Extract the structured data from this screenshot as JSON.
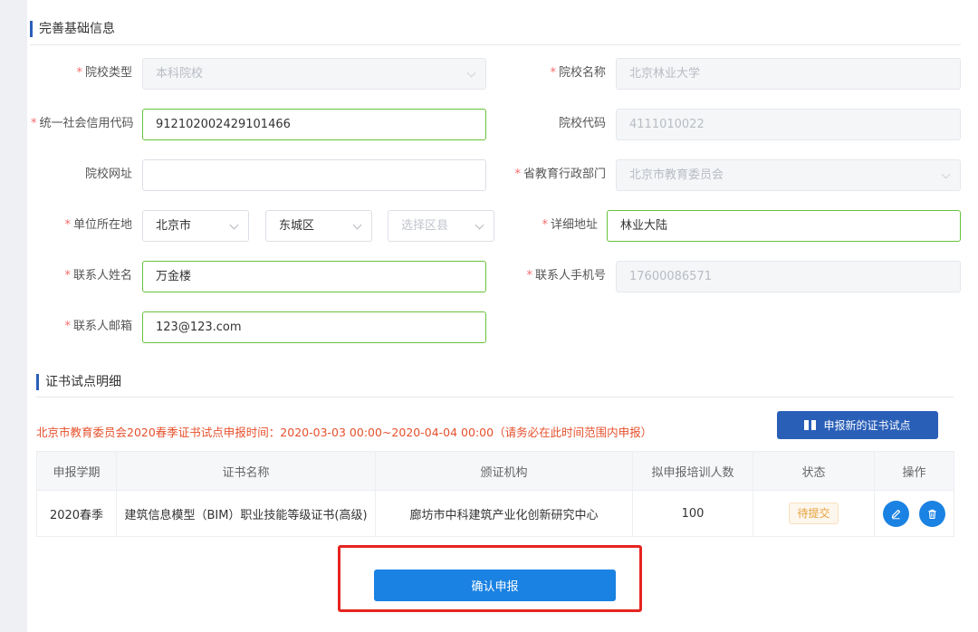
{
  "section1": {
    "title": "完善基础信息"
  },
  "form": {
    "required_mark": "*",
    "school_type": {
      "label": "院校类型",
      "value": "本科院校"
    },
    "school_name": {
      "label": "院校名称",
      "value": "北京林业大学"
    },
    "credit_code": {
      "label": "统一社会信用代码",
      "value": "912102002429101466"
    },
    "school_code": {
      "label": "院校代码",
      "value": "4111010022"
    },
    "website": {
      "label": "院校网址",
      "value": ""
    },
    "edu_dept": {
      "label": "省教育行政部门",
      "value": "北京市教育委员会"
    },
    "location": {
      "label": "单位所在地",
      "city": "北京市",
      "district": "东城区",
      "county_placeholder": "选择区县"
    },
    "address": {
      "label": "详细地址",
      "value": "林业大陆"
    },
    "contact_name": {
      "label": "联系人姓名",
      "value": "万金楼"
    },
    "contact_phone": {
      "label": "联系人手机号",
      "value": "17600086571"
    },
    "contact_email": {
      "label": "联系人邮箱",
      "value": "123@123.com"
    }
  },
  "section2": {
    "title": "证书试点明细",
    "notice": "北京市教育委员会2020春季证书试点申报时间：2020-03-03 00:00~2020-04-04 00:00（请务必在此时间范围内申报）",
    "new_button": "申报新的证书试点"
  },
  "table": {
    "headers": [
      "申报学期",
      "证书名称",
      "颁证机构",
      "拟申报培训人数",
      "状态",
      "操作"
    ],
    "rows": [
      {
        "term": "2020春季",
        "cert": "建筑信息模型（BIM）职业技能等级证书(高级)",
        "org": "廊坊市中科建筑产业化创新研究中心",
        "count": "100",
        "status": "待提交"
      }
    ]
  },
  "confirm_button": "确认申报",
  "colors": {
    "accent": "#1a82e2",
    "navy": "#2a5fb8",
    "notice": "#e6502c",
    "valid_border": "#67c23a",
    "highlight": "#e52420",
    "status": "#e6a23c"
  }
}
